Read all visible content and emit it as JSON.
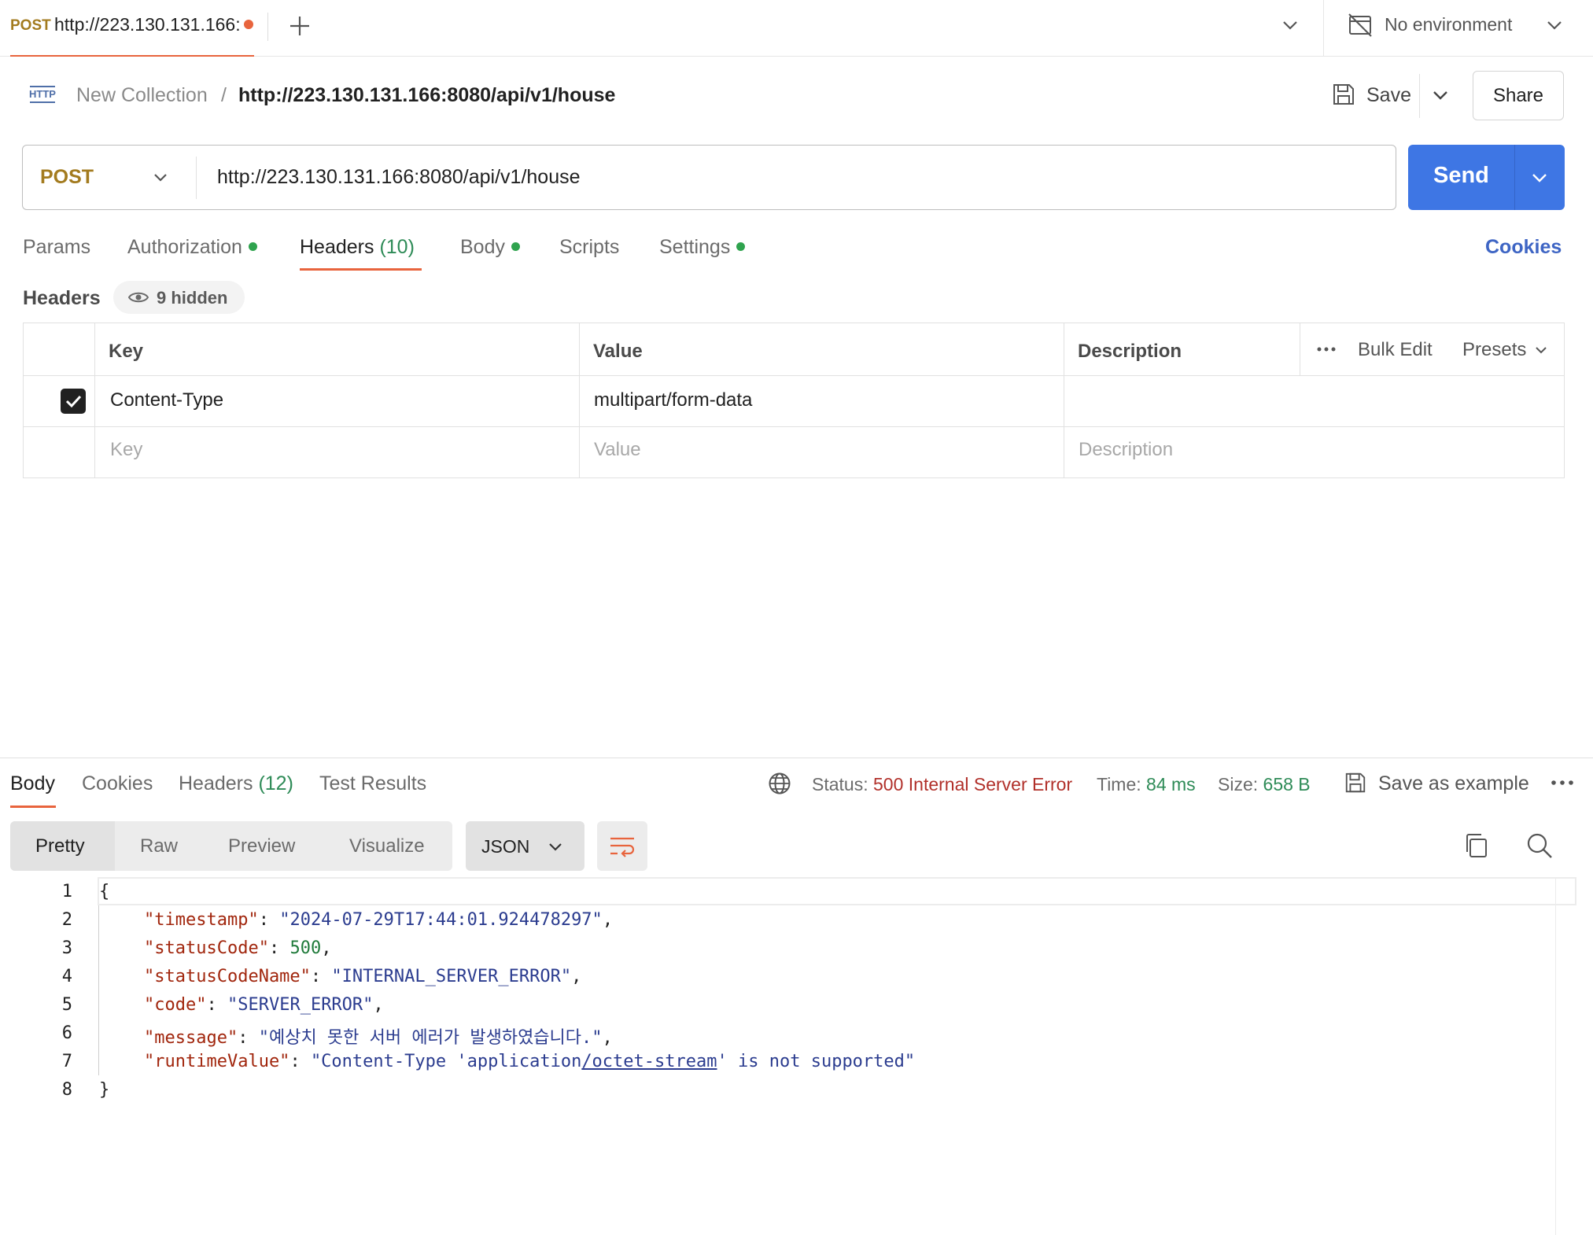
{
  "tab": {
    "method": "POST",
    "url": "http://223.130.131.166:"
  },
  "environment": {
    "label": "No environment"
  },
  "breadcrumb": {
    "collection": "New Collection",
    "separator": "/",
    "request": "http://223.130.131.166:8080/api/v1/house"
  },
  "actions": {
    "save": "Save",
    "share": "Share"
  },
  "request": {
    "method": "POST",
    "url": "http://223.130.131.166:8080/api/v1/house",
    "send": "Send"
  },
  "request_tabs": {
    "params": "Params",
    "authorization": "Authorization",
    "headers": "Headers",
    "headers_count": "(10)",
    "body": "Body",
    "scripts": "Scripts",
    "settings": "Settings",
    "cookies": "Cookies"
  },
  "headers_section": {
    "title": "Headers",
    "hidden": "9 hidden"
  },
  "headers_table": {
    "columns": {
      "key": "Key",
      "value": "Value",
      "description": "Description"
    },
    "bulk_edit": "Bulk Edit",
    "presets": "Presets",
    "rows": [
      {
        "checked": true,
        "key": "Content-Type",
        "value": "multipart/form-data",
        "description": ""
      }
    ],
    "placeholders": {
      "key": "Key",
      "value": "Value",
      "description": "Description"
    }
  },
  "response_tabs": {
    "body": "Body",
    "cookies": "Cookies",
    "headers": "Headers",
    "headers_count": "(12)",
    "tests": "Test Results"
  },
  "response_status": {
    "status_label": "Status:",
    "status_value": "500 Internal Server Error",
    "time_label": "Time:",
    "time_value": "84 ms",
    "size_label": "Size:",
    "size_value": "658 B",
    "save_example": "Save as example"
  },
  "view_modes": {
    "pretty": "Pretty",
    "raw": "Raw",
    "preview": "Preview",
    "visualize": "Visualize",
    "format": "JSON"
  },
  "code": {
    "line_numbers": [
      "1",
      "2",
      "3",
      "4",
      "5",
      "6",
      "7",
      "8"
    ],
    "open": "{",
    "close": "}",
    "timestamp_key": "\"timestamp\"",
    "timestamp_value": "\"2024-07-29T17:44:01.924478297\"",
    "status_code_key": "\"statusCode\"",
    "status_code_value": "500",
    "status_code_name_key": "\"statusCodeName\"",
    "status_code_name_value": "\"INTERNAL_SERVER_ERROR\"",
    "code_key": "\"code\"",
    "code_value": "\"SERVER_ERROR\"",
    "message_key": "\"message\"",
    "message_value": "\"예상치 못한 서버 에러가 발생하였습니다.\"",
    "runtime_key": "\"runtimeValue\"",
    "runtime_value_a": "\"Content-Type 'application",
    "runtime_value_link": "/octet-stream",
    "runtime_value_b": "' is not supported\""
  },
  "colors": {
    "accent": "#e8643d",
    "send": "#3e76e4",
    "method": "#a37b1f",
    "status_error": "#b1302a",
    "success": "#2e8b57"
  }
}
